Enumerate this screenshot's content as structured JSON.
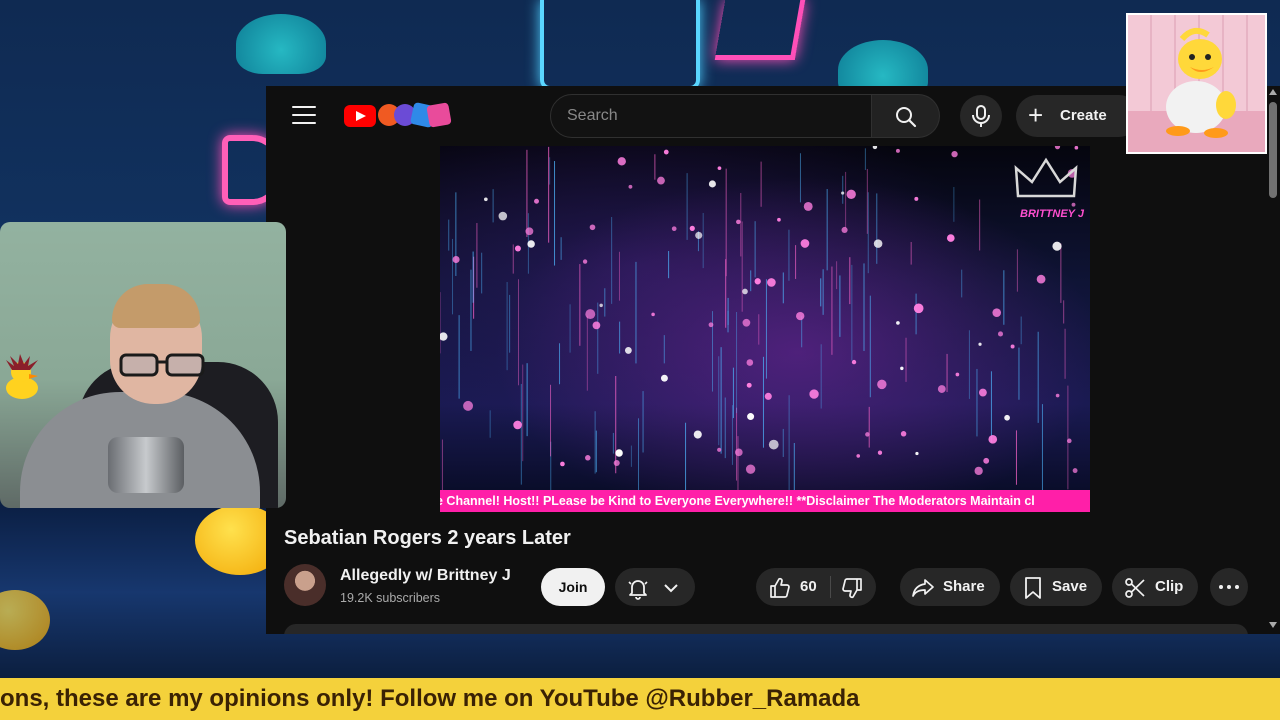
{
  "stream": {
    "bottom_ticker": "ons, these are my opinions only! Follow me on YouTube @Rubber_Ramada"
  },
  "youtube": {
    "search": {
      "placeholder": "Search"
    },
    "create_label": "Create",
    "video": {
      "watermark": "BRITTNEY J",
      "ticker_text": "e Channel! Host!! PLease be Kind to Everyone Everywhere!! **Disclaimer The Moderators Maintain cl",
      "title": "Sebatian Rogers 2 years Later"
    },
    "channel": {
      "name": "Allegedly w/ Brittney J",
      "subscribers": "19.2K subscribers",
      "join_label": "Join"
    },
    "actions": {
      "like_count": "60",
      "share_label": "Share",
      "save_label": "Save",
      "clip_label": "Clip"
    }
  },
  "colors": {
    "youtube_bg": "#0f0f0f",
    "ticker_pink": "#ff1fa8",
    "banner_yellow": "#f4d13b",
    "youtube_red": "#ff0000"
  }
}
